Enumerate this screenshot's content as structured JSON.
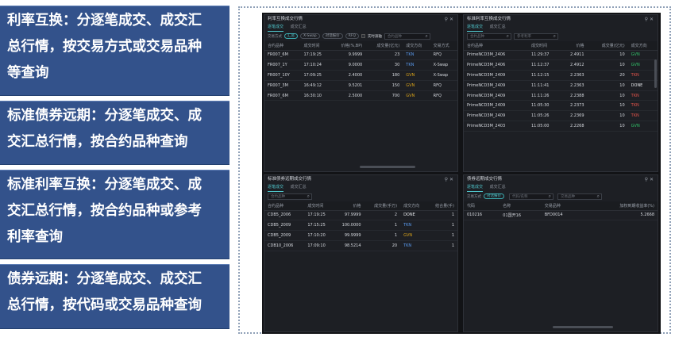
{
  "cards": [
    {
      "lines": [
        "利率互换：分逐笔成交、成交汇",
        "总行情，按交易方式或交易品种",
        "等查询"
      ]
    },
    {
      "lines": [
        "标准债券远期：分逐笔成交、成",
        "交汇总行情，按合约品种查询"
      ]
    },
    {
      "lines": [
        "标准利率互换：分逐笔成交、成",
        "交汇总行情，按合约品种或参考",
        "利率查询"
      ]
    },
    {
      "lines": [
        "债券远期：分逐笔成交、成交汇",
        "总行情，按代码或交易品种查询"
      ]
    }
  ],
  "panels": {
    "tl": {
      "title": "利率互换成交行情",
      "tabs": [
        "逐笔成交",
        "成交汇总"
      ],
      "filter_label": "交易方式",
      "chips": [
        "汇总",
        "X-Swap",
        "对话报价",
        "RFQ"
      ],
      "realtime_label": "实时滚轴",
      "search_placeholder": "合约品种",
      "columns": [
        "合约品种",
        "成交时间",
        "价格(%,BP)",
        "成交量(亿元)",
        "成交方向",
        "交易方式"
      ],
      "rows": [
        [
          "FR007_6M",
          "17:19:25",
          "9.9999",
          "23",
          "TKN",
          "RFQ"
        ],
        [
          "FR007_1Y",
          "17:10:24",
          "9.0000",
          "30",
          "TKN",
          "X-Swap"
        ],
        [
          "FR007_10Y",
          "17:09:25",
          "2.4000",
          "180",
          "GVN",
          "X-Swap"
        ],
        [
          "FR007_3M",
          "16:49:12",
          "9.5201",
          "150",
          "GVN",
          "RFQ"
        ],
        [
          "FR007_6M",
          "16:30:10",
          "2.5000",
          "700",
          "GVN",
          "RFQ"
        ]
      ]
    },
    "tr": {
      "title": "标准利率互换成交行情",
      "tabs": [
        "逐笔成交",
        "成交汇总"
      ],
      "search1": "合约品种",
      "search2": "参考利率",
      "columns": [
        "合约品种",
        "成交时间",
        "价格",
        "成交量(亿元)",
        "成交方向"
      ],
      "rows": [
        [
          "PrimeNCD3M_2406",
          "11:29:37",
          "2.4911",
          "10",
          "GVN"
        ],
        [
          "PrimeNCD3M_2406",
          "11:12:37",
          "2.4912",
          "10",
          "GVN"
        ],
        [
          "PrimeNCD3M_2409",
          "11:12:15",
          "2.2363",
          "20",
          "TKN"
        ],
        [
          "PrimeNCD3M_2409",
          "11:11:41",
          "2.2363",
          "10",
          "DONE"
        ],
        [
          "PrimeNCD3M_2409",
          "11:11:26",
          "2.2388",
          "10",
          "TKN"
        ],
        [
          "PrimeNCD3M_2409",
          "11:05:30",
          "2.2373",
          "10",
          "TKN"
        ],
        [
          "PrimeNCD3M_2409",
          "11:05:26",
          "2.2369",
          "10",
          "TKN"
        ],
        [
          "PrimeNCD3M_2403",
          "11:05:00",
          "2.2268",
          "10",
          "GVN"
        ]
      ]
    },
    "bl": {
      "title": "标准债券远期成交行情",
      "tabs": [
        "逐笔成交",
        "成交汇总"
      ],
      "search": "合约品种",
      "columns": [
        "合约品种",
        "成交时间",
        "价格",
        "成交量(手万)",
        "成交方向",
        "结合量(手)"
      ],
      "rows": [
        [
          "CDB5_2006",
          "17:19:25",
          "97.9999",
          "2",
          "DONE",
          "1"
        ],
        [
          "CDB5_2009",
          "17:15:25",
          "100.0000",
          "1",
          "TKN",
          "1"
        ],
        [
          "CDB5_2009",
          "17:10:20",
          "99.9999",
          "1",
          "GVN",
          "1"
        ],
        [
          "CDB10_2006",
          "17:09:10",
          "98.5214",
          "20",
          "TKN",
          "1"
        ]
      ]
    },
    "br": {
      "title": "债券远期成交行情",
      "tabs": [
        "逐笔成交",
        "成交汇总"
      ],
      "filter_label": "交易方式",
      "chip": "对话报价",
      "search1": "代码/名称",
      "search2": "交易品种",
      "columns": [
        "代码",
        "名称",
        "交易品种",
        "加权到期收益率(%)"
      ],
      "rows": [
        [
          "010216",
          "01国开16",
          "BFD0014",
          "5.2668"
        ]
      ]
    }
  },
  "colors": {
    "card_bg": "#33528b",
    "tkn": "#5a9bf0",
    "gvn": "#d7a21a",
    "txn": "#e0534a",
    "gvn_alt": "#31c46a",
    "tab_active": "#4fc3c9"
  }
}
